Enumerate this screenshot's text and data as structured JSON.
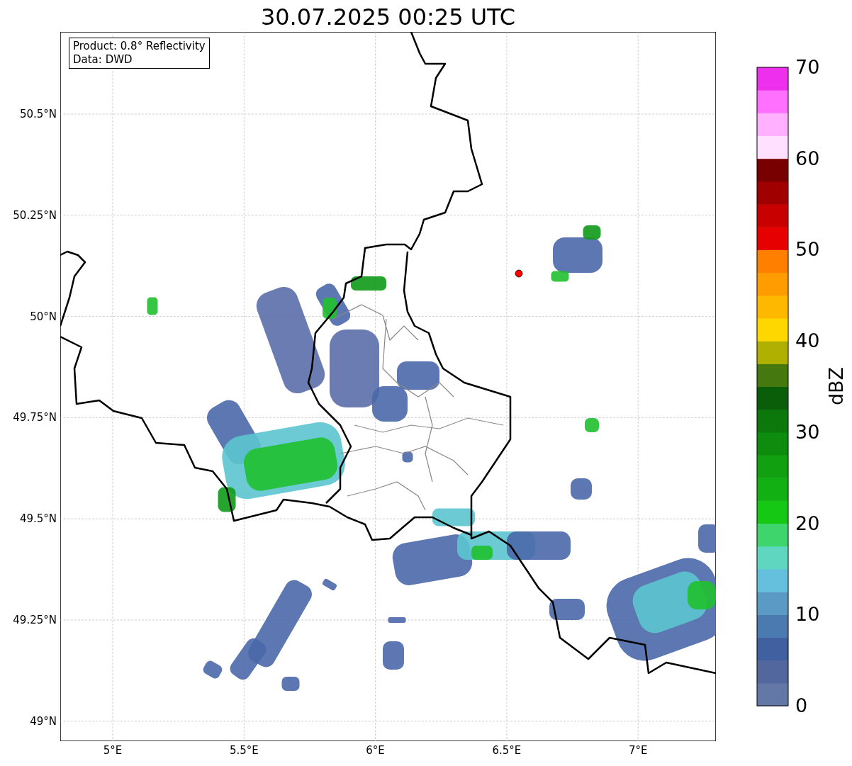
{
  "title": "30.07.2025 00:25 UTC",
  "info_box": [
    "Product: 0.8° Reflectivity",
    "Data: DWD"
  ],
  "map": {
    "yticks": [
      "50.5°N",
      "50.25°N",
      "50°N",
      "49.75°N",
      "49.5°N",
      "49.25°N",
      "49°N"
    ],
    "xticks": [
      "5°E",
      "5.5°E",
      "6°E",
      "6.5°E",
      "7°E"
    ]
  },
  "colorbar": {
    "label": "dBZ",
    "ticks": [
      "70",
      "60",
      "50",
      "40",
      "30",
      "20",
      "10",
      "0"
    ]
  }
}
